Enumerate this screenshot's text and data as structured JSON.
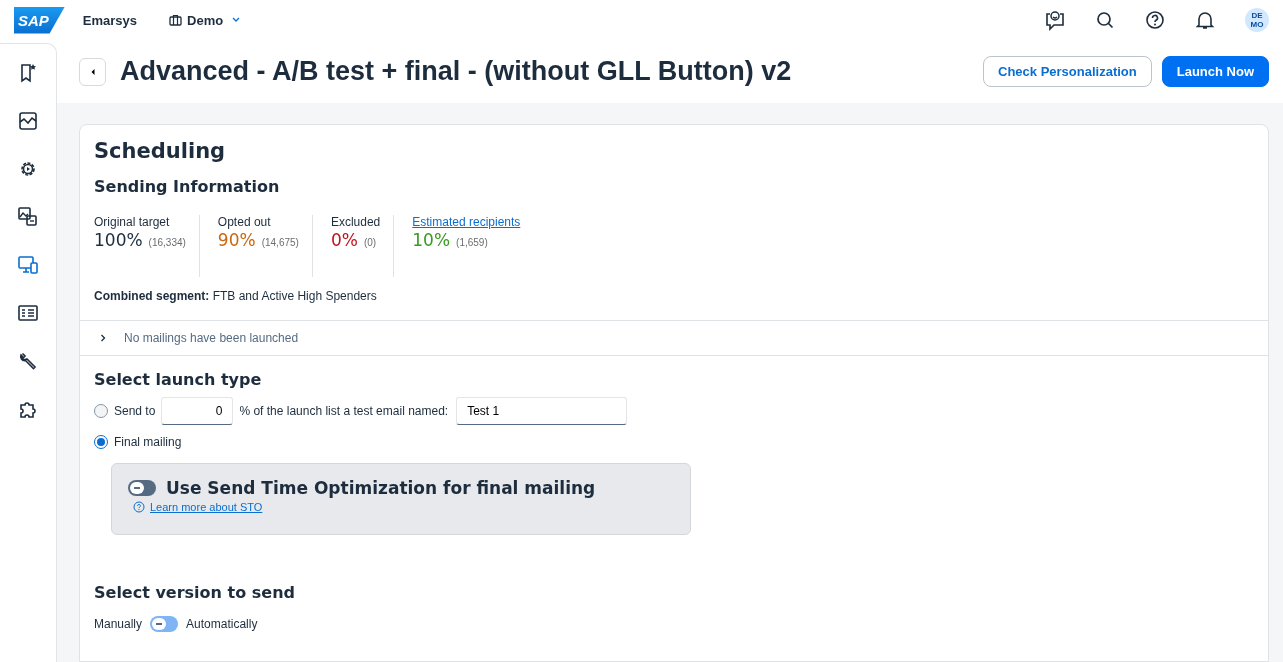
{
  "header": {
    "logo": "SAP",
    "product": "Emarsys",
    "account": "Demo",
    "avatar": "DE MO"
  },
  "sidebar": {
    "items": [
      {
        "kind": "bookmark",
        "selected": false
      },
      {
        "kind": "chart",
        "selected": false
      },
      {
        "kind": "gear",
        "selected": false
      },
      {
        "kind": "images",
        "selected": false
      },
      {
        "kind": "devices",
        "selected": true
      },
      {
        "kind": "card",
        "selected": false
      },
      {
        "kind": "wrench",
        "selected": false
      },
      {
        "kind": "puzzle",
        "selected": false
      }
    ]
  },
  "page": {
    "title": "Advanced - A/B test + final - (without GLL Button) v2",
    "buttons": [
      {
        "label": "Check Personalization",
        "kind": "secondary"
      },
      {
        "label": "Launch Now",
        "kind": "primary"
      }
    ]
  },
  "scheduling": {
    "title": "Scheduling",
    "sending_title": "Sending Information",
    "stats": [
      {
        "label": "Original target",
        "kind": "text",
        "percent": "100%",
        "count": "(16,334)",
        "color": "#1d2d3e"
      },
      {
        "label": "Opted out",
        "kind": "text",
        "percent": "90%",
        "count": "(14,675)",
        "color": "#c8680f"
      },
      {
        "label": "Excluded",
        "kind": "text",
        "percent": "0%",
        "count": "(0)",
        "color": "#c1121f"
      },
      {
        "label": "Estimated recipients",
        "kind": "link",
        "percent": "10%",
        "count": "(1,659)",
        "color": "#3a9a1f"
      }
    ],
    "segment_label": "Combined segment:",
    "segment_value": "FTB and Active High Spenders",
    "mailings": {
      "text": "No mailings have been launched",
      "expanded": false
    }
  },
  "launch_type": {
    "title": "Select launch type",
    "options": [
      {
        "kind": "test",
        "selected": false,
        "prefix": "Send to",
        "percent": "0",
        "middle": "% of the launch list a test email named:",
        "name": "Test 1"
      },
      {
        "kind": "final",
        "selected": true,
        "label": "Final mailing"
      }
    ],
    "sto": {
      "label": "Use Send Time Optimization for final mailing",
      "on": false,
      "link": "Learn more about STO"
    }
  },
  "version": {
    "title": "Select version to send",
    "left": "Manually",
    "right": "Automatically",
    "on": false
  }
}
